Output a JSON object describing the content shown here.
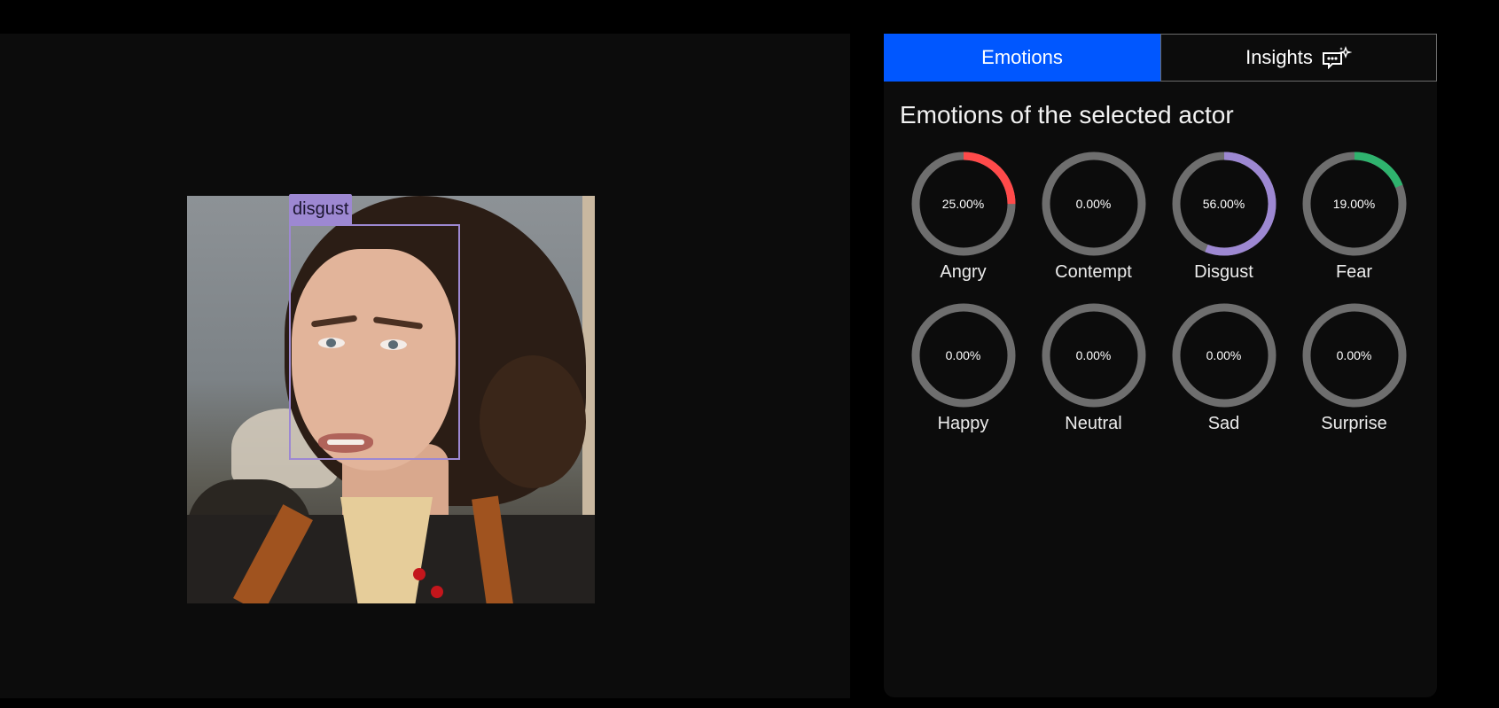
{
  "viewer": {
    "detection_label": "disgust",
    "box_color": "#9d88d2"
  },
  "tabs": [
    {
      "label": "Emotions",
      "active": true
    },
    {
      "label": "Insights",
      "icon": "sparkle-chat-icon",
      "active": false
    }
  ],
  "panel": {
    "title": "Emotions of the selected actor"
  },
  "emotions": [
    {
      "name": "Angry",
      "value": "25.00%",
      "fraction": 0.25,
      "color": "#ff4a4a"
    },
    {
      "name": "Contempt",
      "value": "0.00%",
      "fraction": 0.0,
      "color": "#8a8a8a"
    },
    {
      "name": "Disgust",
      "value": "56.00%",
      "fraction": 0.56,
      "color": "#9d88d2"
    },
    {
      "name": "Fear",
      "value": "19.00%",
      "fraction": 0.19,
      "color": "#2fb36e"
    },
    {
      "name": "Happy",
      "value": "0.00%",
      "fraction": 0.0,
      "color": "#8a8a8a"
    },
    {
      "name": "Neutral",
      "value": "0.00%",
      "fraction": 0.0,
      "color": "#8a8a8a"
    },
    {
      "name": "Sad",
      "value": "0.00%",
      "fraction": 0.0,
      "color": "#8a8a8a"
    },
    {
      "name": "Surprise",
      "value": "0.00%",
      "fraction": 0.0,
      "color": "#8a8a8a"
    }
  ],
  "colors": {
    "accent": "#0057ff",
    "track": "#6e6e6e"
  }
}
